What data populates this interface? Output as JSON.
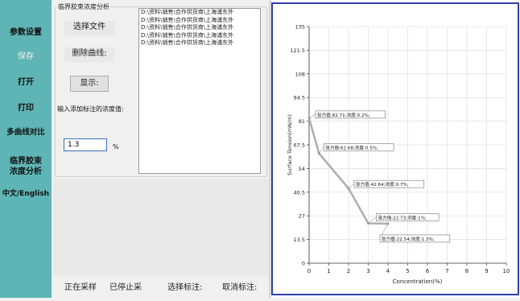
{
  "sidebar": {
    "items": [
      {
        "label": "参数设置"
      },
      {
        "label": "保存"
      },
      {
        "label": "打开"
      },
      {
        "label": "打印"
      },
      {
        "label": "多曲线对比"
      },
      {
        "label": "临界胶束浓度分析"
      },
      {
        "label": "中文/English"
      }
    ]
  },
  "panel": {
    "group_title": "临界胶束浓度分析",
    "select_file": "选择文件",
    "delete_curve": "删除曲线:",
    "show": "显示:",
    "annotation_prompt": "输入添加标注的浓度值:",
    "annotation_value": "1.3",
    "unit": "%",
    "files": [
      "D:\\资料\\销售\\合作供货商\\上海浦东外",
      "D:\\资料\\销售\\合作供货商\\上海浦东外",
      "D:\\资料\\销售\\合作供货商\\上海浦东外",
      "D:\\资料\\销售\\合作供货商\\上海浦东外",
      "D:\\资料\\销售\\合作供货商\\上海浦东外"
    ]
  },
  "footer": {
    "sampling": "正在采样",
    "stopped": "已停止采",
    "select_annotation": "选择标注:",
    "cancel_annotation": "取消标注:"
  },
  "colors": {
    "sidebar": "#5fb4b5",
    "frame": "#2f3fa8",
    "curve": "#b0b0b0"
  },
  "chart_data": {
    "type": "line",
    "xlabel": "Concentration(%)",
    "ylabel": "Surface Tension(mN/m)",
    "xlim": [
      0,
      10
    ],
    "ylim": [
      0,
      135
    ],
    "x_ticks": [
      "0",
      "1",
      "2",
      "3",
      "4",
      "5",
      "6",
      "7",
      "8",
      "9",
      "10"
    ],
    "y_ticks": [
      "0",
      "13.5",
      "27",
      "40.5",
      "54",
      "67.5",
      "81",
      "94.5",
      "108",
      "121.5",
      "135"
    ],
    "grid": true,
    "series": [
      {
        "x": [
          0,
          0.5,
          2,
          3,
          4
        ],
        "y": [
          82.71,
          62.68,
          42.64,
          22.73,
          22.54
        ]
      }
    ],
    "annotations": [
      {
        "text": "张力值:82.71;浓度:0.2%;"
      },
      {
        "text": "张力值:62.68;浓度:0.5%;"
      },
      {
        "text": "张力值:42.64;浓度:0.7%;"
      },
      {
        "text": "张力值:22.73;浓度:1%;"
      },
      {
        "text": "张力值:22.54;浓度:1.3%;"
      }
    ]
  }
}
